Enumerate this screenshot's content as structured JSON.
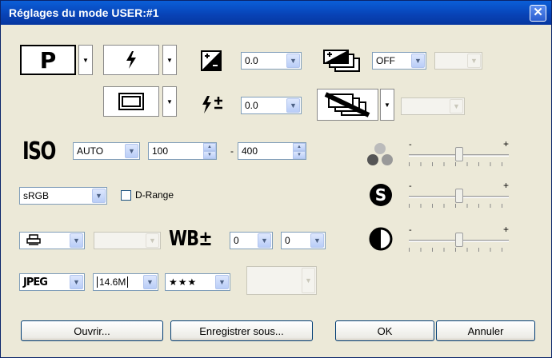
{
  "title": "Réglages du mode USER:#1",
  "mode_letter": "P",
  "flash_icon": "flash-icon",
  "exposure_comp": "0.0",
  "flash_comp": "0.0",
  "bracket": "OFF",
  "iso_label": "ISO",
  "iso_mode": "AUTO",
  "iso_min": "100",
  "iso_sep": "-",
  "iso_max": "400",
  "color_space": "sRGB",
  "drange_label": "D-Range",
  "wb_label": "WB±",
  "wb_a": "0",
  "wb_b": "0",
  "format": "JPEG",
  "size": "14.6M",
  "quality": "★★★",
  "buttons": {
    "open": "Ouvrir...",
    "save_as": "Enregistrer sous...",
    "ok": "OK",
    "cancel": "Annuler"
  },
  "slider_minus": "-",
  "slider_plus": "+",
  "sliders": {
    "saturation": 0.5,
    "sharpness": 0.5,
    "contrast": 0.5
  }
}
